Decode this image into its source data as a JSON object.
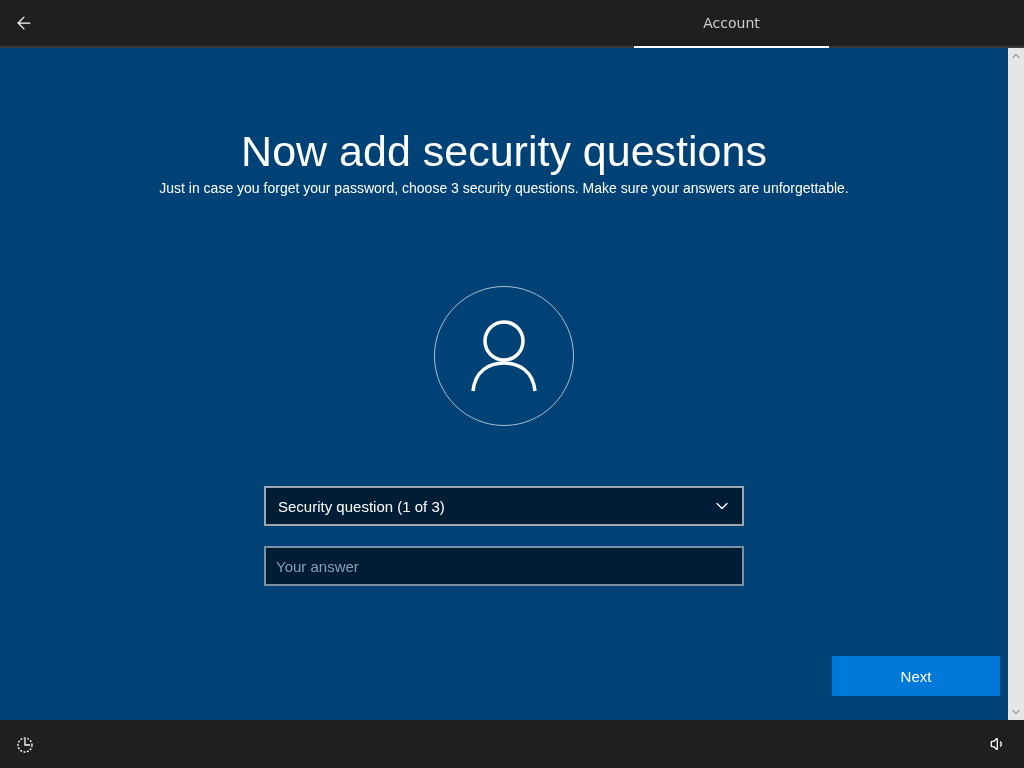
{
  "header": {
    "tabs": [
      {
        "label": "Account",
        "selected": true
      }
    ]
  },
  "page": {
    "title": "Now add security questions",
    "subtitle": "Just in case you forget your password, choose 3 security questions. Make sure your answers are unforgettable."
  },
  "question_dropdown": {
    "value": "Security question (1 of 3)"
  },
  "answer_field": {
    "placeholder": "Your answer"
  },
  "next_button": {
    "label": "Next"
  }
}
